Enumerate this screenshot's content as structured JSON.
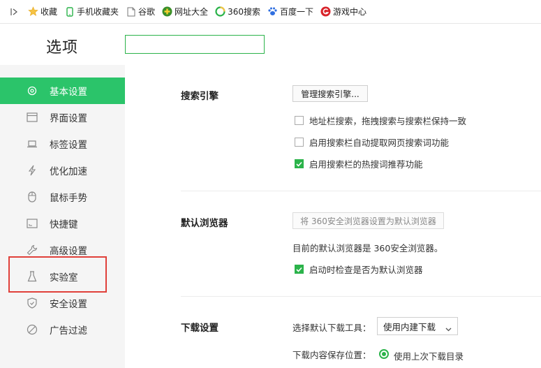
{
  "bookmarks": [
    {
      "label": "收藏",
      "icon": "star-icon"
    },
    {
      "label": "手机收藏夹",
      "icon": "phone-icon"
    },
    {
      "label": "谷歌",
      "icon": "page-icon"
    },
    {
      "label": "网址大全",
      "icon": "plus-circle-icon"
    },
    {
      "label": "360搜索",
      "icon": "360-search-icon"
    },
    {
      "label": "百度一下",
      "icon": "paw-icon"
    },
    {
      "label": "游戏中心",
      "icon": "game-icon"
    }
  ],
  "header": {
    "title": "选项",
    "search_value": ""
  },
  "sidebar": {
    "items": [
      {
        "label": "基本设置",
        "icon": "gear-icon",
        "active": true
      },
      {
        "label": "界面设置",
        "icon": "window-icon"
      },
      {
        "label": "标签设置",
        "icon": "tab-icon"
      },
      {
        "label": "优化加速",
        "icon": "lightning-icon"
      },
      {
        "label": "鼠标手势",
        "icon": "mouse-icon"
      },
      {
        "label": "快捷键",
        "icon": "keyboard-icon"
      },
      {
        "label": "高级设置",
        "icon": "wrench-icon"
      },
      {
        "label": "实验室",
        "icon": "flask-icon"
      },
      {
        "label": "安全设置",
        "icon": "shield-icon"
      },
      {
        "label": "广告过滤",
        "icon": "block-icon"
      }
    ]
  },
  "search_engine": {
    "title": "搜索引擎",
    "manage_button": "管理搜索引擎...",
    "options": [
      {
        "label": "地址栏搜索，拖拽搜索与搜索栏保持一致",
        "checked": false
      },
      {
        "label": "启用搜索栏自动提取网页搜索词功能",
        "checked": false
      },
      {
        "label": "启用搜索栏的热搜词推荐功能",
        "checked": true
      }
    ]
  },
  "default_browser": {
    "title": "默认浏览器",
    "set_button": "将 360安全浏览器设置为默认浏览器",
    "status_text": "目前的默认浏览器是 360安全浏览器。",
    "check_option": {
      "label": "启动时检查是否为默认浏览器",
      "checked": true
    }
  },
  "download": {
    "title": "下载设置",
    "tool_label": "选择默认下载工具：",
    "tool_value": "使用内建下载",
    "location_label": "下载内容保存位置：",
    "location_option": "使用上次下载目录"
  },
  "colors": {
    "accent": "#2bc46a",
    "highlight_border": "#e0403a"
  }
}
